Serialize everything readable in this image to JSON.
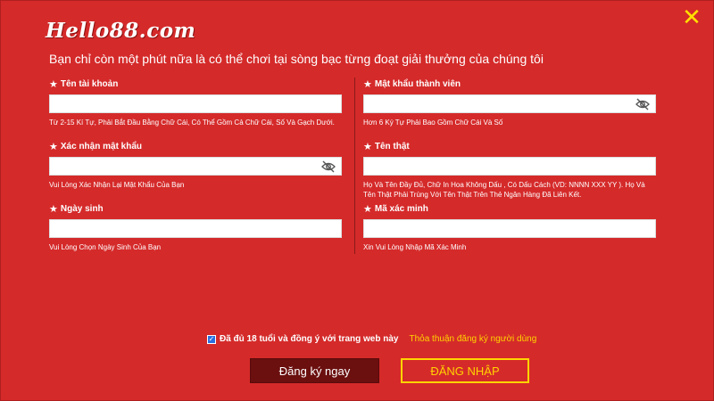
{
  "brand": {
    "logo_text": "Hello88.com",
    "accent": "#ffd400",
    "background": "#d52a2a"
  },
  "subtitle": "Bạn chỉ còn một phút nữa là có thể chơi tại sòng bạc từng đoạt giải thưởng của chúng tôi",
  "close_icon": "close-icon",
  "fields": {
    "username": {
      "label": "Tên tài khoản",
      "value": "",
      "hint": "Từ 2-15 Kí Tự, Phải Bắt Đầu Bằng Chữ Cái, Có Thể Gồm Cả Chữ Cái, Số Và Gạch Dưới."
    },
    "password": {
      "label": "Mật khẩu thành viên",
      "value": "",
      "hint": "Hơn 6 Ký Tự Phải Bao Gồm Chữ Cái Và Số"
    },
    "confirm_password": {
      "label": "Xác nhận mật khẩu",
      "value": "",
      "hint": "Vui Lòng Xác Nhận Lại Mật Khẩu Của Bạn"
    },
    "real_name": {
      "label": "Tên thật",
      "value": "",
      "hint": "Họ Và Tên Đầy Đủ, Chữ In Hoa Không Dấu , Có Dấu Cách (VD: NNNN XXX YY ). Họ Và Tên Thật Phải Trùng Với Tên Thật Trên Thẻ Ngân Hàng Đã Liên Kết."
    },
    "dob": {
      "label": "Ngày sinh",
      "value": "",
      "hint": "Vui Lòng Chọn Ngày Sinh Của Bạn"
    },
    "captcha": {
      "label": "Mã xác minh",
      "value": "",
      "hint": "Xin Vui Lòng Nhập Mã Xác Minh"
    }
  },
  "agreement": {
    "checked": true,
    "text": "Đã đủ 18 tuổi và đồng ý với trang web này",
    "link": "Thỏa thuận đăng ký người dùng"
  },
  "buttons": {
    "register": "Đăng ký ngay",
    "login": "ĐĂNG NHẬP"
  }
}
